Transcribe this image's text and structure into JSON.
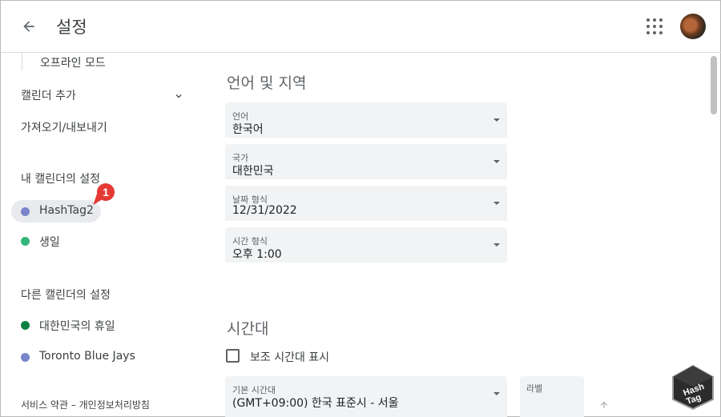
{
  "header": {
    "title": "설정"
  },
  "sidebar": {
    "offline_mode": "오프라인 모드",
    "add_calendar": "캘린더 추가",
    "import_export": "가져오기/내보내기",
    "my_calendars_heading": "내 캘린더의 설정",
    "my_calendars": [
      {
        "label": "HashTag2",
        "color": "#7986cb",
        "selected": true
      },
      {
        "label": "생일",
        "color": "#33b679",
        "selected": false
      }
    ],
    "other_calendars_heading": "다른 캘린더의 설정",
    "other_calendars": [
      {
        "label": "대한민국의 휴일",
        "color": "#0b8043"
      },
      {
        "label": "Toronto Blue Jays",
        "color": "#7986cb"
      }
    ],
    "terms": "서비스 약관 – 개인정보처리방침"
  },
  "annotation": {
    "badge": "1",
    "color": "#e53935"
  },
  "main": {
    "language_region_title": "언어 및 지역",
    "language": {
      "label": "언어",
      "value": "한국어"
    },
    "country": {
      "label": "국가",
      "value": "대한민국"
    },
    "date_format": {
      "label": "날짜 형식",
      "value": "12/31/2022"
    },
    "time_format": {
      "label": "시간 형식",
      "value": "오후 1:00"
    },
    "timezone_title": "시간대",
    "secondary_timezone_label": "보조 시간대 표시",
    "secondary_timezone_checked": false,
    "primary_timezone": {
      "label": "기본 시간대",
      "value": "(GMT+09:00) 한국 표준시 - 서울"
    },
    "timezone_label_field": {
      "label": "라벨"
    }
  },
  "watermark": {
    "line1": "Hash",
    "line2": "Tag"
  }
}
